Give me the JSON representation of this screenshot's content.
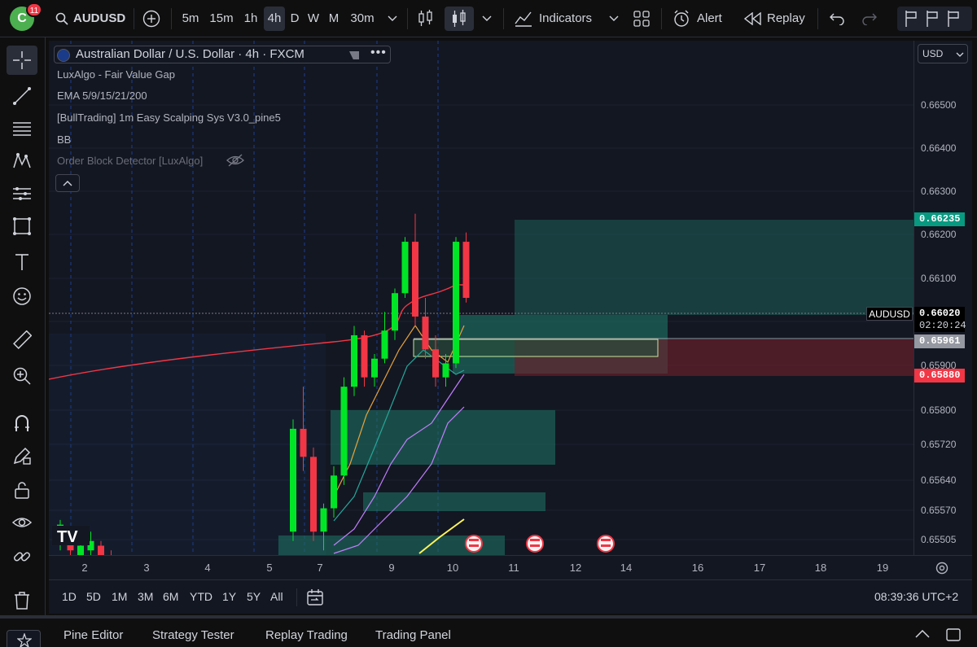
{
  "toolbar": {
    "avatar_letter": "C",
    "notification_count": "11",
    "symbol": "AUDUSD",
    "timeframes": [
      "5m",
      "15m",
      "1h",
      "4h",
      "D",
      "W",
      "M",
      "30m"
    ],
    "active_timeframe": "4h",
    "indicators_label": "Indicators",
    "alert_label": "Alert",
    "replay_label": "Replay"
  },
  "legend": {
    "symbol_title": "Australian Dollar / U.S. Dollar · 4h · FXCM",
    "indicators": [
      "LuxAlgo - Fair Value Gap",
      "EMA 5/9/15/21/200",
      "[BullTrading] 1m Easy Scalping Sys V3.0_pine5",
      "BB",
      "Order Block Detector [LuxAlgo]"
    ]
  },
  "price_scale": {
    "currency": "USD",
    "labels": [
      "0.66500",
      "0.66400",
      "0.66300",
      "0.66200",
      "0.66100",
      "0.65900",
      "0.65800",
      "0.65720",
      "0.65640",
      "0.65570",
      "0.65505"
    ],
    "tags": {
      "upper": "0.66235",
      "current_symbol": "AUDUSD",
      "current": "0.66020",
      "countdown": "02:20:24",
      "mid": "0.65961",
      "lower": "0.65880"
    }
  },
  "time_scale": {
    "labels": [
      "2",
      "3",
      "4",
      "5",
      "7",
      "9",
      "10",
      "11",
      "12",
      "14",
      "16",
      "17",
      "18",
      "19"
    ]
  },
  "range_bar": {
    "ranges": [
      "1D",
      "5D",
      "1M",
      "3M",
      "6M",
      "YTD",
      "1Y",
      "5Y",
      "All"
    ],
    "clock": "08:39:36 UTC+2"
  },
  "bottom_tabs": [
    "Pine Editor",
    "Strategy Tester",
    "Replay Trading",
    "Trading Panel"
  ],
  "colors": {
    "bull": "#00e626",
    "bear": "#f23645",
    "zone_teal": "#1e6f63",
    "zone_red": "#6b1e2b",
    "tag_green": "#089981",
    "tag_red": "#f23645",
    "tag_gray": "#787b86"
  },
  "chart_data": {
    "type": "candlestick",
    "candles": [
      {
        "o": 0.65535,
        "h": 0.65545,
        "l": 0.6548,
        "c": 0.65505,
        "d": "bull"
      },
      {
        "o": 0.6551,
        "h": 0.6552,
        "l": 0.6547,
        "c": 0.6548,
        "d": "bear"
      },
      {
        "o": 0.6547,
        "h": 0.655,
        "l": 0.6544,
        "c": 0.6549,
        "d": "bull"
      },
      {
        "o": 0.6548,
        "h": 0.6552,
        "l": 0.6547,
        "c": 0.655,
        "d": "bull"
      },
      {
        "o": 0.6549,
        "h": 0.655,
        "l": 0.6545,
        "c": 0.6547,
        "d": "bear"
      },
      {
        "o": 0.6546,
        "h": 0.6548,
        "l": 0.6543,
        "c": 0.6544,
        "d": "bear"
      },
      {
        "o": 0.6552,
        "h": 0.6576,
        "l": 0.655,
        "c": 0.6574,
        "d": "bull"
      },
      {
        "o": 0.6574,
        "h": 0.6583,
        "l": 0.6565,
        "c": 0.6568,
        "d": "bear"
      },
      {
        "o": 0.6568,
        "h": 0.657,
        "l": 0.655,
        "c": 0.6552,
        "d": "bear"
      },
      {
        "o": 0.6552,
        "h": 0.6558,
        "l": 0.6548,
        "c": 0.6557,
        "d": "bull"
      },
      {
        "o": 0.6557,
        "h": 0.6566,
        "l": 0.6555,
        "c": 0.6564,
        "d": "bull"
      },
      {
        "o": 0.6564,
        "h": 0.6585,
        "l": 0.6562,
        "c": 0.6583,
        "d": "bull"
      },
      {
        "o": 0.6583,
        "h": 0.6596,
        "l": 0.6581,
        "c": 0.6594,
        "d": "bull"
      },
      {
        "o": 0.6594,
        "h": 0.6595,
        "l": 0.6583,
        "c": 0.6585,
        "d": "bear"
      },
      {
        "o": 0.6585,
        "h": 0.659,
        "l": 0.6583,
        "c": 0.6589,
        "d": "bull"
      },
      {
        "o": 0.6589,
        "h": 0.6599,
        "l": 0.6588,
        "c": 0.6595,
        "d": "bull"
      },
      {
        "o": 0.6595,
        "h": 0.6604,
        "l": 0.6593,
        "c": 0.6603,
        "d": "bull"
      },
      {
        "o": 0.6603,
        "h": 0.6615,
        "l": 0.6602,
        "c": 0.6614,
        "d": "bull"
      },
      {
        "o": 0.6614,
        "h": 0.662,
        "l": 0.6596,
        "c": 0.6598,
        "d": "bear"
      },
      {
        "o": 0.6598,
        "h": 0.6602,
        "l": 0.6589,
        "c": 0.6591,
        "d": "bear"
      },
      {
        "o": 0.6591,
        "h": 0.6594,
        "l": 0.6583,
        "c": 0.6585,
        "d": "bear"
      },
      {
        "o": 0.6585,
        "h": 0.659,
        "l": 0.6583,
        "c": 0.6588,
        "d": "bull"
      },
      {
        "o": 0.6588,
        "h": 0.6615,
        "l": 0.6587,
        "c": 0.6614,
        "d": "bull"
      },
      {
        "o": 0.6614,
        "h": 0.6616,
        "l": 0.6601,
        "c": 0.6602,
        "d": "bear"
      }
    ],
    "ylim": [
      0.6547,
      0.6657
    ]
  }
}
